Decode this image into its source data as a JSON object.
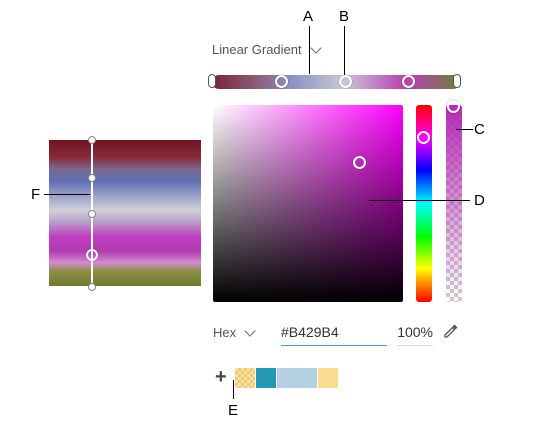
{
  "callouts": {
    "a": "A",
    "b": "B",
    "c": "C",
    "d": "D",
    "e": "E",
    "f": "F"
  },
  "gradient_type": {
    "selected": "Linear Gradient"
  },
  "color": {
    "format": "Hex",
    "hex_value": "#B429B4",
    "opacity": "100%"
  },
  "swatches": [
    "#fbe3a8",
    "#2399b5",
    "#b5cfe3",
    "#b5cfe3",
    "#fbdb8e"
  ],
  "icons": {
    "add": "plus-icon",
    "eyedropper": "eyedropper-icon",
    "dropdown": "chevron-down-icon"
  },
  "add_label": "+"
}
